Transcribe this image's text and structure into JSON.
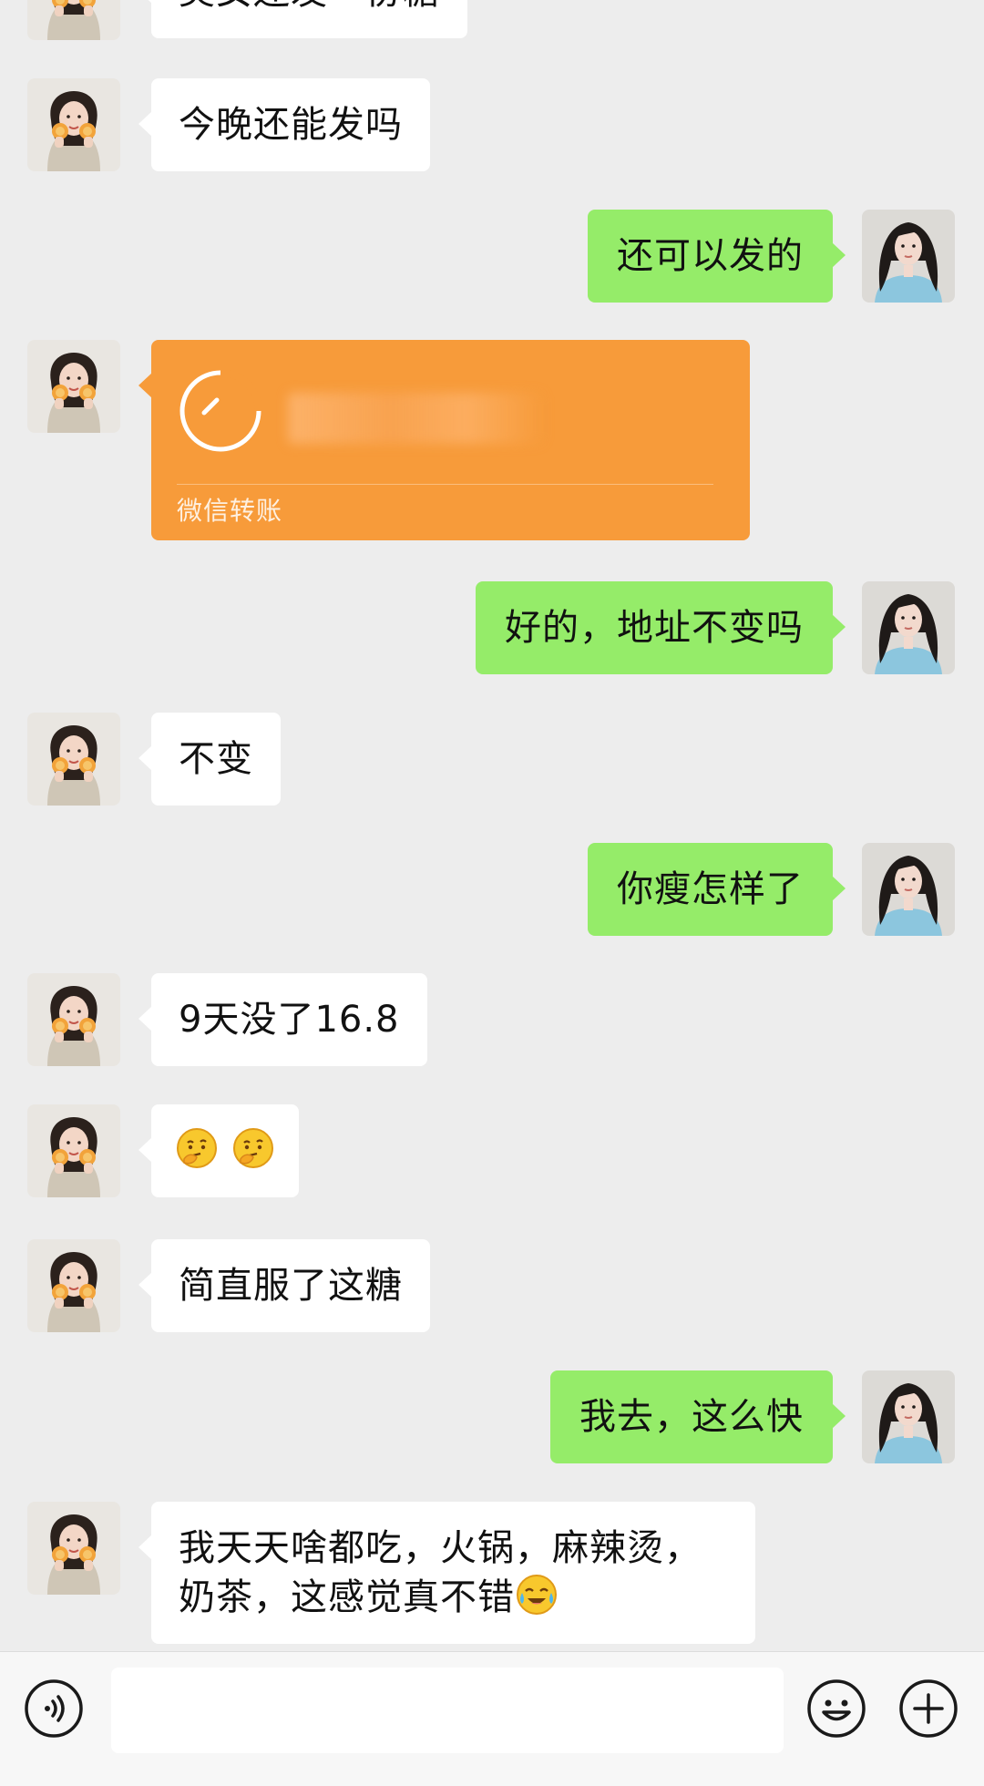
{
  "messages": [
    {
      "side": "in",
      "text": "美女还发一份糖"
    },
    {
      "side": "in",
      "text": "今晚还能发吗"
    },
    {
      "side": "out",
      "text": "还可以发的"
    },
    {
      "side": "in",
      "type": "transfer",
      "label": "微信转账"
    },
    {
      "side": "out",
      "text": "好的，地址不变吗"
    },
    {
      "side": "in",
      "text": "不变"
    },
    {
      "side": "out",
      "text": "你瘦怎样了"
    },
    {
      "side": "in",
      "text": "9天没了16.8"
    },
    {
      "side": "in",
      "type": "emoji",
      "emoji": [
        "thinking-face-icon",
        "thinking-face-icon"
      ]
    },
    {
      "side": "in",
      "text": "简直服了这糖"
    },
    {
      "side": "out",
      "text": "我去，这么快"
    },
    {
      "side": "in",
      "line1": "我天天啥都吃，火锅，麻辣烫，",
      "line2": "奶茶，这感觉真不错",
      "trailing_emoji": "laughing-crying-face-icon"
    }
  ],
  "toolbar": {
    "voice_icon": "voice-icon",
    "emoji_icon": "smiley-icon",
    "plus_icon": "plus-icon"
  },
  "colors": {
    "background": "#ededed",
    "incoming_bubble": "#ffffff",
    "outgoing_bubble": "#95ec69",
    "transfer_card": "#f79b3a"
  }
}
